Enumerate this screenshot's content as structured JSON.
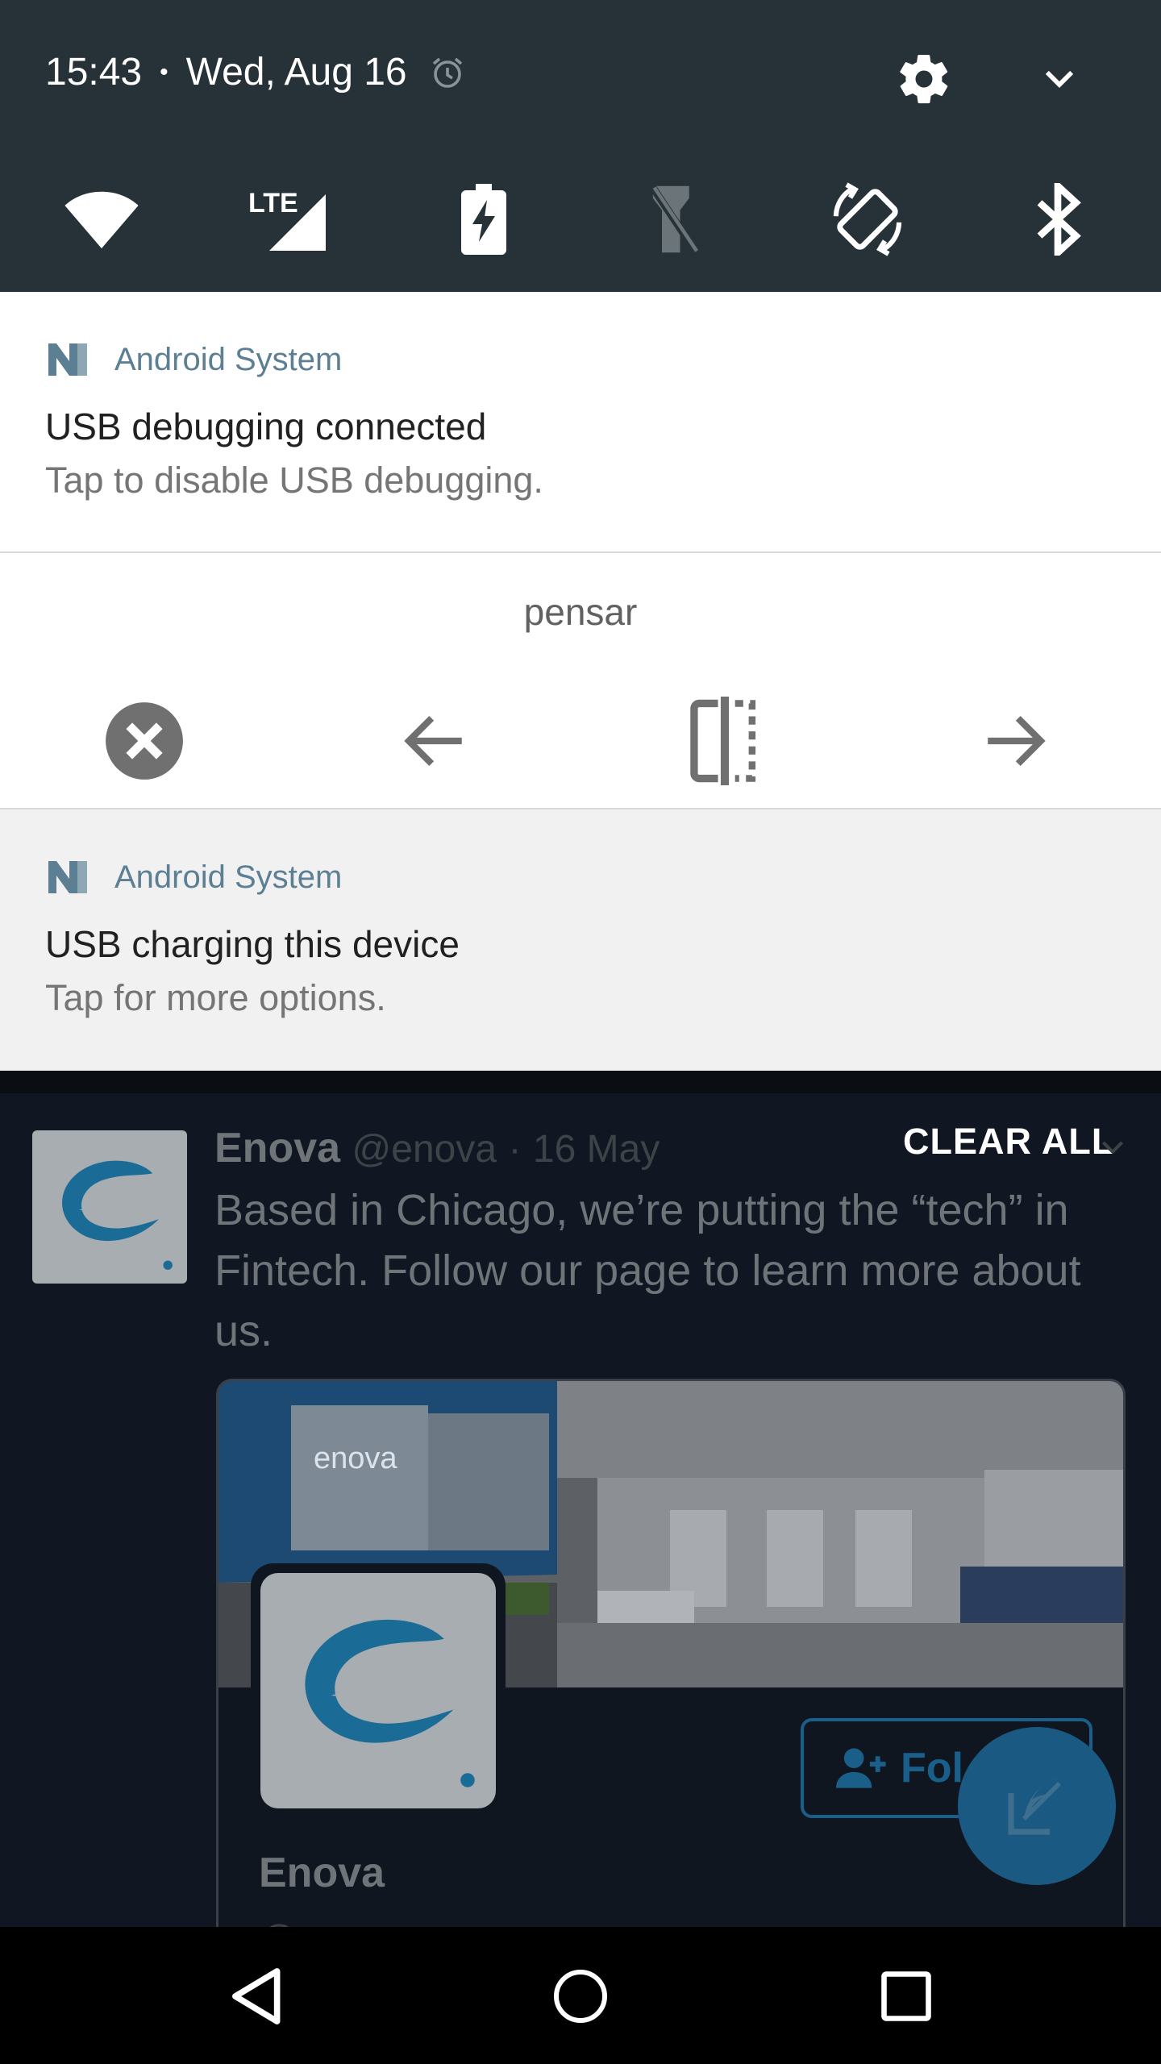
{
  "status": {
    "time": "15:43",
    "separator": "•",
    "date": "Wed, Aug 16"
  },
  "quick_settings": {
    "tiles": [
      "wifi-icon",
      "lte-signal-icon",
      "battery-saver-icon",
      "flashlight-icon",
      "auto-rotate-icon",
      "bluetooth-icon"
    ],
    "lte_label": "LTE",
    "colors": {
      "background": "#263238",
      "icon": "#ffffff",
      "icon_disabled": "#6b7479"
    }
  },
  "notifications": [
    {
      "app": "Android System",
      "title": "USB debugging connected",
      "text": "Tap to disable USB debugging."
    },
    {
      "title": "pensar",
      "actions": [
        "close-icon",
        "arrow-back-icon",
        "split-icon",
        "arrow-forward-icon"
      ]
    },
    {
      "app": "Android System",
      "title": "USB charging this device",
      "text": "Tap for more options."
    }
  ],
  "clear_all_label": "CLEAR ALL",
  "background_tweet": {
    "name": "Enova",
    "handle": "@enova",
    "dot": "·",
    "date": "16 May",
    "body": "Based in Chicago, we’re putting the “tech” in Fintech. Follow our page to learn more about us.",
    "photo_text": "enova",
    "card_name": "Enova",
    "card_handle": "@enova",
    "follow_label": "Fol"
  },
  "colors": {
    "app_name": "#5c7f93",
    "accent_blue": "#1a5f8a",
    "scrim": "#101722"
  }
}
